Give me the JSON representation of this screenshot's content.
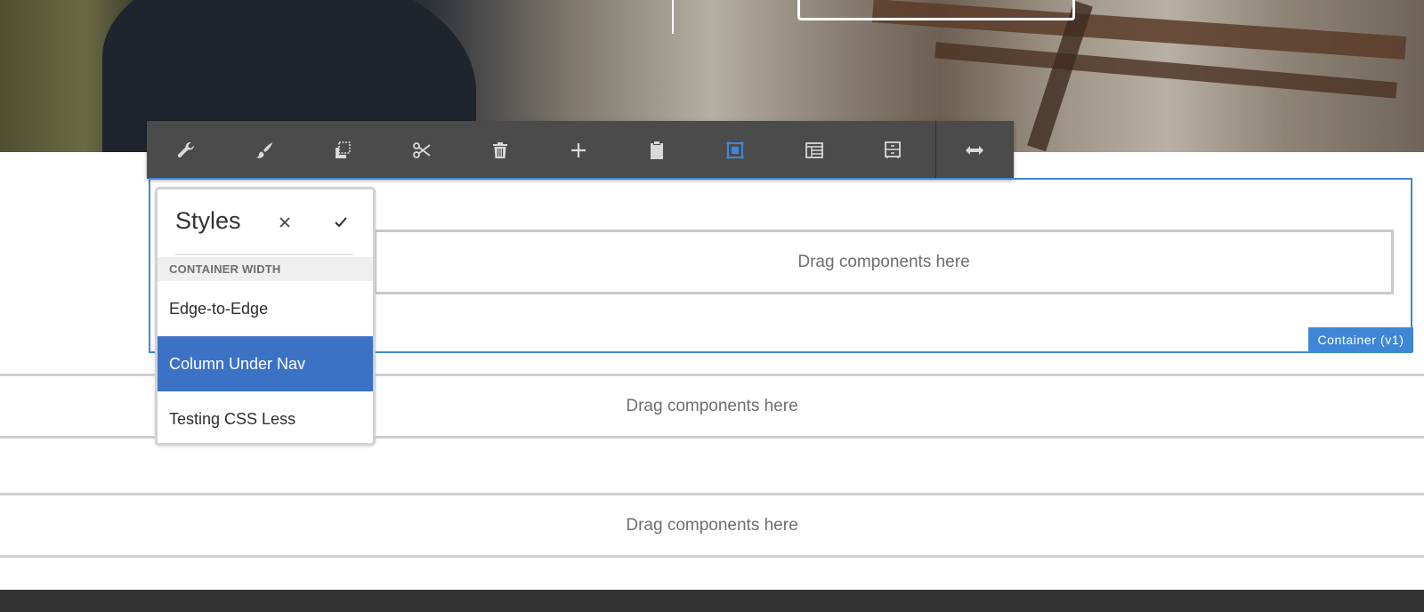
{
  "toolbar": {
    "items": [
      {
        "name": "configure-icon"
      },
      {
        "name": "styles-icon"
      },
      {
        "name": "copy-icon"
      },
      {
        "name": "cut-icon"
      },
      {
        "name": "delete-icon"
      },
      {
        "name": "insert-icon"
      },
      {
        "name": "paste-icon"
      },
      {
        "name": "select-parent-icon"
      },
      {
        "name": "layout-icon"
      },
      {
        "name": "group-icon"
      },
      {
        "name": "resize-icon"
      }
    ],
    "active_color": "#3f87d6"
  },
  "styles_popover": {
    "title": "Styles",
    "section": "CONTAINER WIDTH",
    "options": [
      "Edge-to-Edge",
      "Column Under Nav",
      "Testing CSS Less"
    ],
    "selected": "Column Under Nav"
  },
  "container": {
    "badge": "Container (v1)",
    "dropzone_label": "Drag components here"
  },
  "rows": [
    {
      "dropzone_label": "Drag components here"
    },
    {
      "dropzone_label": "Drag components here"
    }
  ],
  "colors": {
    "selection": "#3f87d6",
    "selected_option": "#3c72c6",
    "toolbar": "#4b4b4b"
  }
}
